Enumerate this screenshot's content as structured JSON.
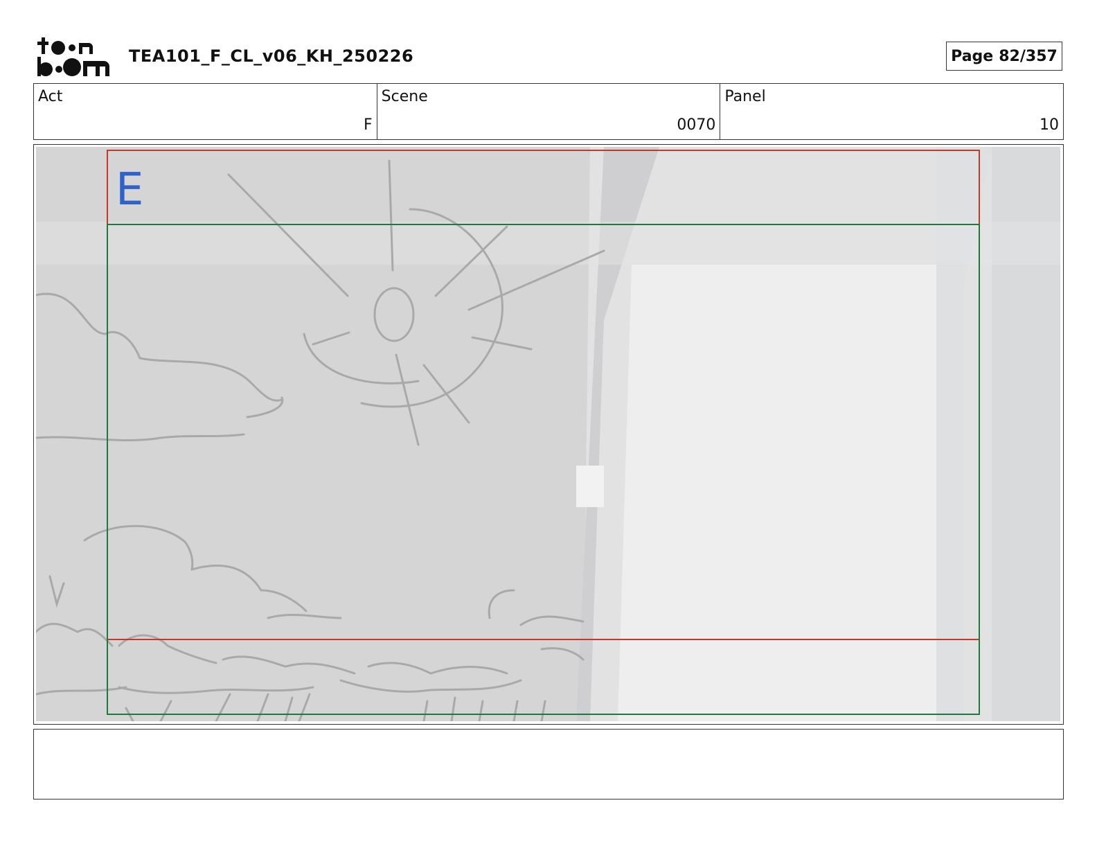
{
  "header": {
    "logo_text": "toon boom",
    "document_title": "TEA101_F_CL_v06_KH_250226",
    "page_label": "Page",
    "page_number": "82/357"
  },
  "info": {
    "act_label": "Act",
    "act_value": "F",
    "scene_label": "Scene",
    "scene_value": "0070",
    "panel_label": "Panel",
    "panel_value": "10"
  },
  "panel": {
    "field_marker": "E",
    "colors": {
      "safe_frame": "#c0392b",
      "camera_frame": "#1e7a3a",
      "marker": "#2c62c9"
    }
  },
  "notes": {
    "text": ""
  }
}
